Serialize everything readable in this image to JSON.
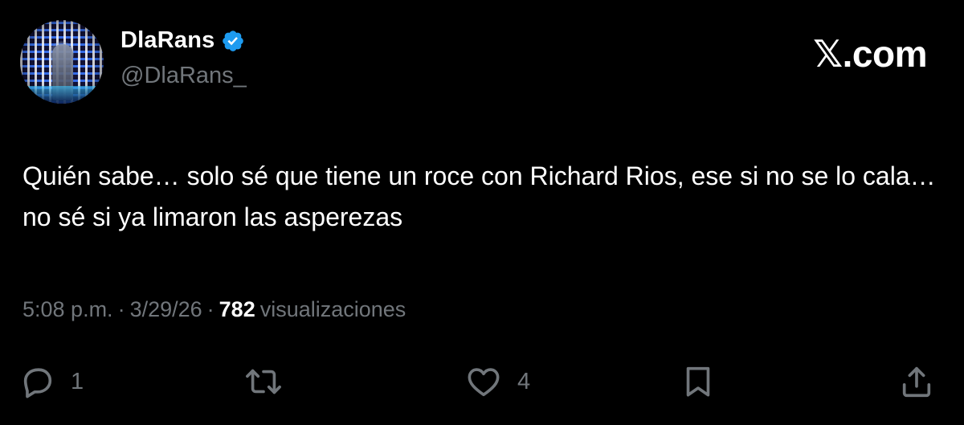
{
  "author": {
    "display_name": "DlaRans",
    "handle": "@DlaRans_",
    "verified": true,
    "verified_color": "#1d9bf0",
    "avatar_icon": "profile-photo"
  },
  "brand": {
    "label": "𝕏.com"
  },
  "tweet": {
    "text": "Quién sabe… solo sé que tiene un roce con Richard Rios, ese si no se lo cala… no sé si ya limaron las asperezas"
  },
  "meta": {
    "time": "5:08 p.m.",
    "sep1": "·",
    "date": "3/29/26",
    "sep2": "·",
    "views_count": "782",
    "views_label": "visualizaciones"
  },
  "actions": {
    "reply": {
      "icon": "reply-icon",
      "count": "1"
    },
    "repost": {
      "icon": "repost-icon",
      "count": ""
    },
    "like": {
      "icon": "heart-icon",
      "count": "4"
    },
    "bookmark": {
      "icon": "bookmark-icon"
    },
    "share": {
      "icon": "share-icon"
    }
  },
  "colors": {
    "background": "#000000",
    "text_primary": "#ffffff",
    "text_secondary": "#71767b"
  }
}
